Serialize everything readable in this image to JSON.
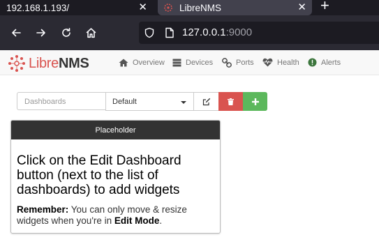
{
  "browser": {
    "tabs": [
      {
        "label": "192.168.1.193/",
        "close": "✕"
      },
      {
        "label": "LibreNMS",
        "close": "✕"
      }
    ],
    "new_tab": "+",
    "url_host": "127.0.0.1",
    "url_port": ":9000"
  },
  "app": {
    "logo": {
      "part1": "Libre",
      "part2": "NMS"
    },
    "menu": [
      {
        "label": "Overview",
        "icon": "home-icon"
      },
      {
        "label": "Devices",
        "icon": "server-icon"
      },
      {
        "label": "Ports",
        "icon": "link-icon"
      },
      {
        "label": "Health",
        "icon": "heartbeat-icon"
      },
      {
        "label": "Alerts",
        "icon": "exclamation-circle-icon"
      }
    ]
  },
  "dashboard": {
    "input_placeholder": "Dashboards",
    "selected": "Default"
  },
  "widget": {
    "title": "Placeholder",
    "message": "Click on the Edit Dashboard button (next to the list of dashboards) to add widgets",
    "remember_label": "Remember:",
    "remember_text": " You can only move & resize widgets when you're in ",
    "edit_mode": "Edit Mode",
    "period": "."
  },
  "colors": {
    "brand_red": "#d9534f",
    "success_green": "#5cb85c",
    "widget_header": "#333333",
    "browser_dark": "#1c1b22"
  }
}
